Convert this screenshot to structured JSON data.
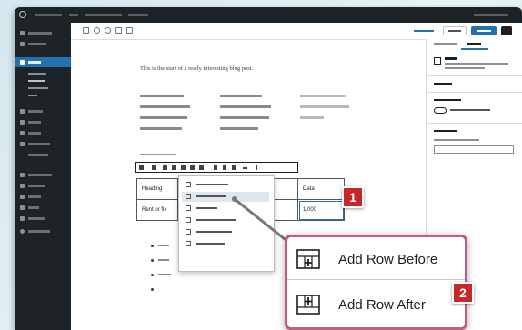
{
  "table": {
    "row1": [
      "Heading",
      "",
      "",
      "Data"
    ],
    "row2": [
      "Rent or fix",
      "",
      "",
      "1,000"
    ]
  },
  "editor_paragraph": "This is the start of a really interesting blog post.",
  "zoom_menu": {
    "items": [
      {
        "label": "Add Row Before",
        "icon": "table-row-before-icon"
      },
      {
        "label": "Add Row After",
        "icon": "table-row-after-icon"
      }
    ]
  },
  "callouts": {
    "one": "1",
    "two": "2"
  },
  "colors": {
    "callout": "#c62828",
    "zoom_border": "#c75a7e",
    "admin_dark": "#1d2327",
    "accent": "#2271b1"
  }
}
